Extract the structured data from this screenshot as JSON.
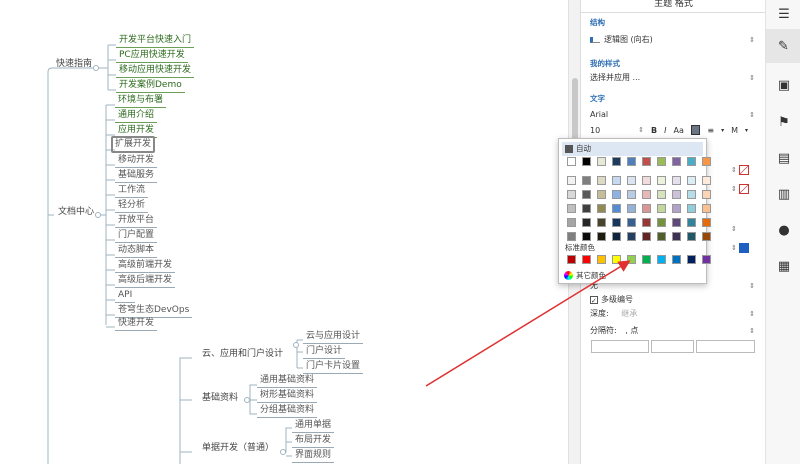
{
  "mindmap": {
    "quick_guide": {
      "label": "快速指南",
      "children": [
        "开发平台快速入门",
        "PC应用快速开发",
        "移动应用快速开发",
        "开发案例Demo"
      ]
    },
    "doc_center": {
      "label": "文档中心",
      "children": [
        "环境与布署",
        "通用介绍",
        "应用开发",
        "扩展开发",
        "移动开发",
        "基础服务",
        "工作流",
        "轻分析",
        "开放平台",
        "门户配置",
        "动态脚本",
        "高级前端开发",
        "高级后端开发",
        "API",
        "苍穹生态DevOps",
        "快速开发"
      ]
    },
    "cloud_app": {
      "label": "云、应用和门户设计",
      "children": [
        "云与应用设计",
        "门户设计",
        "门户卡片设置"
      ]
    },
    "basic_data": {
      "label": "基础资料",
      "children": [
        "通用基础资料",
        "树形基础资料",
        "分组基础资料"
      ]
    },
    "bill_dev": {
      "label": "单据开发（普通）",
      "children": [
        "通用单据",
        "布局开发",
        "界面规则"
      ]
    }
  },
  "panel": {
    "title": "主题 格式",
    "structure_label": "结构",
    "structure_value": "逻辑图 (向右)",
    "my_style_label": "我的样式",
    "my_style_value": "选择并应用 ...",
    "text_label": "文字",
    "font_value": "Arial",
    "font_size": "10",
    "bold": "B",
    "italic": "I",
    "case": "Aa",
    "more": "M",
    "multi_level_label": "多级编号",
    "depth_label": "深度:",
    "depth_value": "继承",
    "separator_label": "分隔符:",
    "separator_value": ", 点",
    "truncated_label": "无"
  },
  "colorpicker": {
    "auto_label": "自动",
    "standard_label": "标准颜色",
    "more_label": "其它颜色",
    "top_row": [
      "#ffffff",
      "#000000",
      "#e8e8d8",
      "#1f3a5f",
      "#4f7fbd",
      "#c0504d",
      "#9bbb59",
      "#8064a2",
      "#4bacc6",
      "#f79646"
    ],
    "shade_rows": [
      [
        "#f2f2f2",
        "#7f7f7f",
        "#ddd9c3",
        "#c6d9f0",
        "#dbe5f1",
        "#f2dcdb",
        "#ebf1dd",
        "#e5e0ec",
        "#dbeef3",
        "#fdeada"
      ],
      [
        "#d8d8d8",
        "#595959",
        "#c4bd97",
        "#8db3e2",
        "#b8cce4",
        "#e5b9b7",
        "#d7e3bc",
        "#ccc1d9",
        "#b7dde8",
        "#fbd5b5"
      ],
      [
        "#bfbfbf",
        "#3f3f3f",
        "#938953",
        "#548dd4",
        "#95b3d7",
        "#d99694",
        "#c3d69b",
        "#b2a2c7",
        "#92cddc",
        "#fac08f"
      ],
      [
        "#a5a5a5",
        "#262626",
        "#494429",
        "#17365d",
        "#366092",
        "#953734",
        "#76923c",
        "#5f497a",
        "#31859b",
        "#e36c09"
      ],
      [
        "#7f7f7f",
        "#0c0c0c",
        "#1d1b10",
        "#0f243e",
        "#244061",
        "#632423",
        "#4f6128",
        "#3f3151",
        "#205867",
        "#974806"
      ]
    ],
    "standard": [
      "#c00000",
      "#ff0000",
      "#ffc000",
      "#ffff00",
      "#92d050",
      "#00b050",
      "#00b0f0",
      "#0070c0",
      "#002060",
      "#7030a0"
    ]
  },
  "colors": {
    "green_text": "#2d6a1e",
    "accent_blue": "#2f6fb3",
    "arrow_red": "#e03030"
  },
  "sidebar_icons": [
    "outline-icon",
    "paint-brush-icon",
    "image-icon",
    "flag-icon",
    "label-icon",
    "note-icon",
    "comment-icon",
    "task-icon"
  ]
}
